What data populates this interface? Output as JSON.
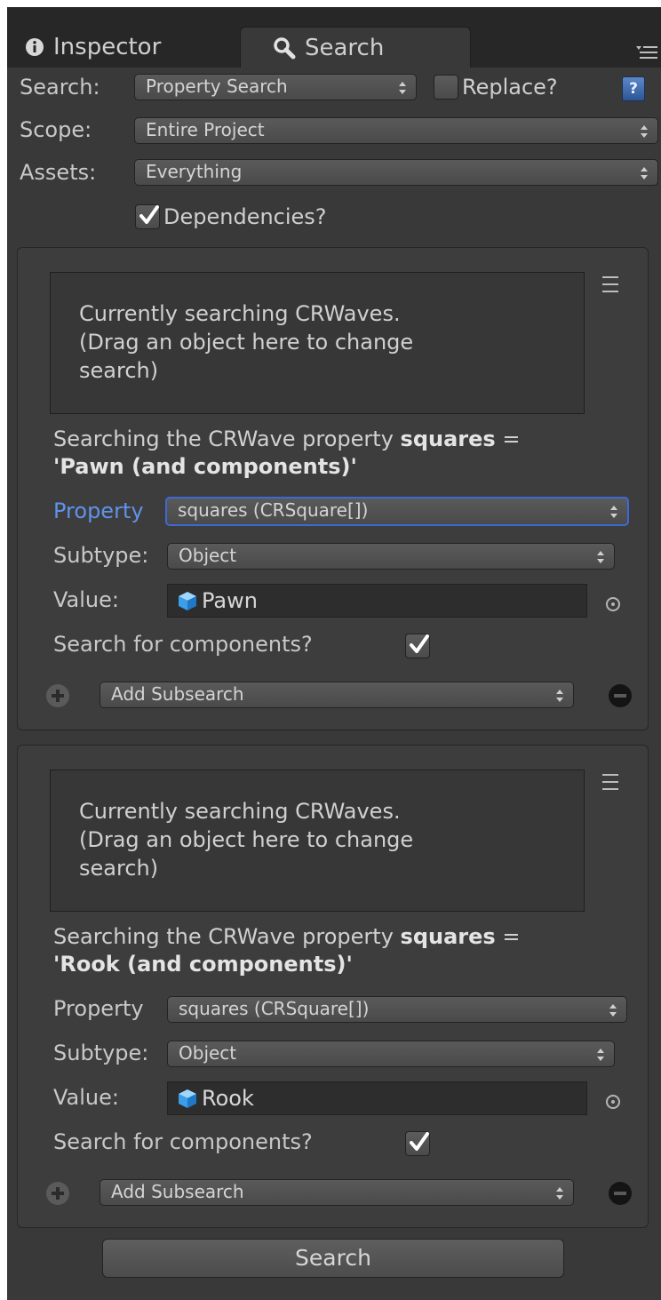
{
  "tabs": {
    "inspector": "Inspector",
    "search": "Search"
  },
  "search_row": {
    "label": "Search:",
    "value": "Property Search"
  },
  "replace": {
    "label": "Replace?",
    "checked": false
  },
  "help_icon": "?",
  "scope_row": {
    "label": "Scope:",
    "value": "Entire Project"
  },
  "assets_row": {
    "label": "Assets:",
    "value": "Everything"
  },
  "dependencies": {
    "label": "Dependencies?",
    "checked": true
  },
  "subsearches": [
    {
      "dropzone_text": "Currently searching CRWaves.\n(Drag an object here to change search)",
      "description_prefix": "Searching the CRWave property ",
      "description_property": "squares",
      "description_eq": " =",
      "description_value": "'Pawn (and components)'",
      "property_label": "Property",
      "property_value": "squares (CRSquare[])",
      "subtype_label": "Subtype:",
      "subtype_value": "Object",
      "value_label": "Value:",
      "value": "Pawn",
      "components_label": "Search for components?",
      "components_checked": true,
      "add_subsearch": "Add Subsearch"
    },
    {
      "dropzone_text": "Currently searching CRWaves.\n(Drag an object here to change search)",
      "description_prefix": "Searching the CRWave property ",
      "description_property": "squares",
      "description_eq": " =",
      "description_value": "'Rook (and components)'",
      "property_label": "Property",
      "property_value": "squares (CRSquare[])",
      "subtype_label": "Subtype:",
      "subtype_value": "Object",
      "value_label": "Value:",
      "value": "Rook",
      "components_label": "Search for components?",
      "components_checked": true,
      "add_subsearch": "Add Subsearch"
    }
  ],
  "search_button": "Search",
  "colors": {
    "background": "#393939",
    "panel": "#3d3d3d",
    "focus": "#3d69d6",
    "active_label": "#5f93ea"
  }
}
